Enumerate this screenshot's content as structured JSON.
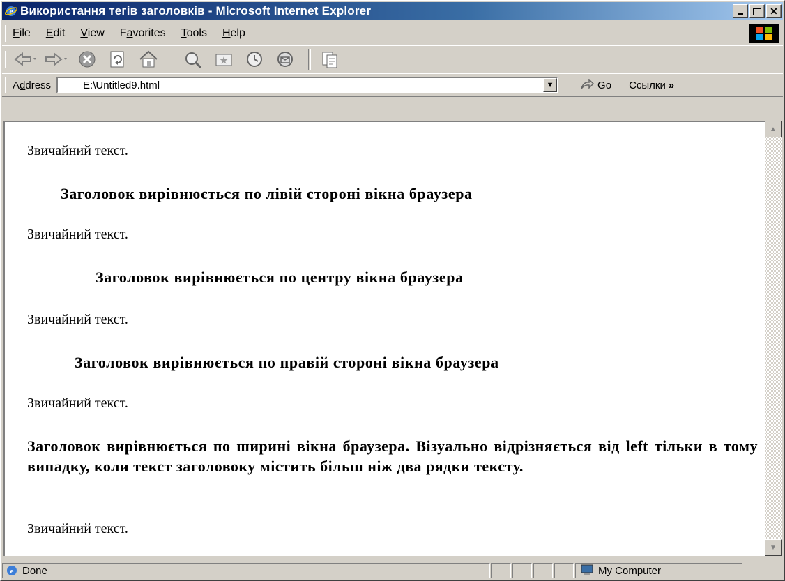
{
  "window": {
    "title": "Використання тегів заголовків - Microsoft Internet Explorer"
  },
  "menu": {
    "items": [
      {
        "label": "File",
        "accel": "F",
        "rest": "ile"
      },
      {
        "label": "Edit",
        "accel": "E",
        "rest": "dit"
      },
      {
        "label": "View",
        "accel": "V",
        "rest": "iew"
      },
      {
        "label": "Favorites",
        "pre": "F",
        "accel": "a",
        "rest": "vorites"
      },
      {
        "label": "Tools",
        "accel": "T",
        "rest": "ools"
      },
      {
        "label": "Help",
        "accel": "H",
        "rest": "elp"
      }
    ]
  },
  "toolbar": {
    "buttons": [
      "back-icon",
      "forward-icon",
      "stop-icon",
      "refresh-icon",
      "home-icon",
      "search-icon",
      "favorites-icon",
      "history-icon",
      "mail-icon",
      "edit-icon"
    ]
  },
  "address": {
    "pre": "A",
    "accel": "d",
    "rest": "dress",
    "value": "E:\\Untitled9.html",
    "go_label": "Go",
    "links_label": "Ссылки"
  },
  "page": {
    "normal_text": "Звичайний текст.",
    "heading_left": "Заголовок вирівнюється по лівій стороні вікна браузера",
    "heading_center": "Заголовок вирівнюється по центру вікна браузера",
    "heading_right": "Заголовок вирівнюється по правій стороні вікна браузера",
    "heading_justify": "Заголовок вирівнюється по ширині вікна браузера. Візуально відрізняється від left тільки в тому випадку, коли текст заголовоку містить більш ніж два рядки тексту."
  },
  "status": {
    "text": "Done",
    "zone": "My Computer"
  },
  "colors": {
    "title_start": "#0a246a",
    "title_end": "#a6caf0",
    "chrome": "#d4d0c8"
  }
}
